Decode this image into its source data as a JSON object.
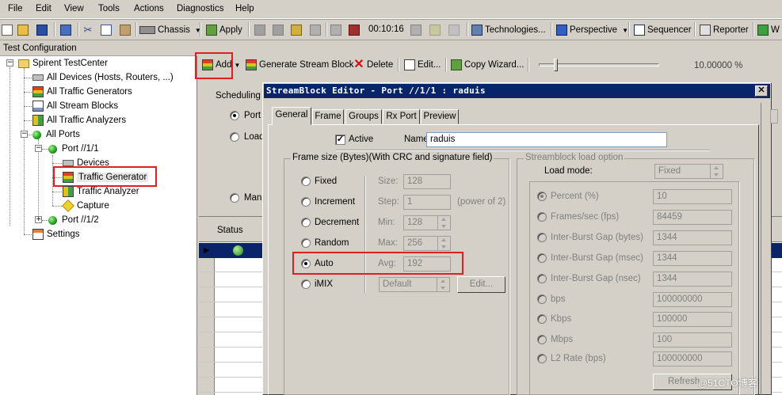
{
  "menubar": [
    "File",
    "Edit",
    "View",
    "Tools",
    "Actions",
    "Diagnostics",
    "Help"
  ],
  "toolbar": {
    "chassis": "Chassis",
    "apply": "Apply",
    "timer": "00:10:16",
    "technologies": "Technologies...",
    "perspective": "Perspective",
    "sequencer": "Sequencer",
    "reporter": "Reporter",
    "last": "W"
  },
  "pane_title": "Test Configuration",
  "tree": {
    "root": "Spirent TestCenter",
    "all_devices": "All Devices (Hosts, Routers, ...)",
    "all_traffic_generators": "All Traffic Generators",
    "all_stream_blocks": "All Stream Blocks",
    "all_traffic_analyzers": "All Traffic Analyzers",
    "all_ports": "All Ports",
    "port1": "Port //1/1",
    "devices": "Devices",
    "traffic_generator": "Traffic Generator",
    "traffic_analyzer": "Traffic Analyzer",
    "capture": "Capture",
    "port2": "Port //1/2",
    "settings": "Settings"
  },
  "main_toolbar": {
    "add": "Add",
    "generate": "Generate Stream Block",
    "delete": "Delete",
    "edit": "Edit...",
    "copy_wizard": "Copy Wizard...",
    "zoom": "10.00000 %"
  },
  "scheduling": {
    "label": "Scheduling M",
    "port": "Port",
    "load": "Load",
    "manual": "Manu"
  },
  "grid": {
    "status_header": "Status"
  },
  "dialog": {
    "title": "StreamBlock Editor - Port //1/1 : raduis",
    "tabs": [
      "General",
      "Frame",
      "Groups",
      "Rx Port",
      "Preview"
    ],
    "active_label": "Active",
    "active_checked": true,
    "name_label": "Name:",
    "name_value": "raduis",
    "frame_size": {
      "title": "Frame size (Bytes)(With CRC and signature field)",
      "options": [
        "Fixed",
        "Increment",
        "Decrement",
        "Random",
        "Auto",
        "iMIX"
      ],
      "selected": "Auto",
      "size_label": "Size:",
      "size_value": "128",
      "step_label": "Step:",
      "step_value": "1",
      "power_of_2": "(power of 2)",
      "min_label": "Min:",
      "min_value": "128",
      "max_label": "Max:",
      "max_value": "256",
      "avg_label": "Avg:",
      "avg_value": "192",
      "imix_value": "Default",
      "imix_edit": "Edit..."
    },
    "load_option": {
      "title": "Streamblock load option",
      "load_mode_label": "Load mode:",
      "load_mode_value": "Fixed",
      "rows": [
        {
          "label": "Percent (%)",
          "value": "10",
          "checked": true
        },
        {
          "label": "Frames/sec (fps)",
          "value": "84459",
          "checked": false
        },
        {
          "label": "Inter-Burst Gap (bytes)",
          "value": "1344",
          "checked": false
        },
        {
          "label": "Inter-Burst Gap (msec)",
          "value": "1344",
          "checked": false
        },
        {
          "label": "Inter-Burst Gap (nsec)",
          "value": "1344",
          "checked": false
        },
        {
          "label": "bps",
          "value": "100000000",
          "checked": false
        },
        {
          "label": "Kbps",
          "value": "100000",
          "checked": false
        },
        {
          "label": "Mbps",
          "value": "100",
          "checked": false
        },
        {
          "label": "L2 Rate (bps)",
          "value": "100000000",
          "checked": false
        }
      ],
      "refresh": "Refresh"
    }
  },
  "watermark": "@51CTO博客"
}
